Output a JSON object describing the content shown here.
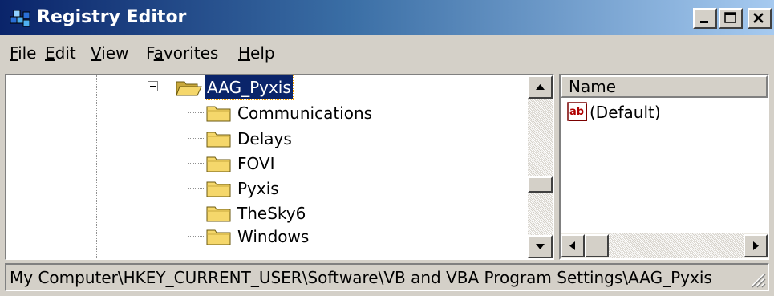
{
  "window": {
    "title": "Registry Editor",
    "controls": {
      "minimize": "_",
      "maximize": "□",
      "close": "×"
    }
  },
  "menu": {
    "file": {
      "hot": "F",
      "rest": "ile"
    },
    "edit": {
      "hot": "E",
      "rest": "dit"
    },
    "view": {
      "hot": "V",
      "rest": "iew"
    },
    "favorites": {
      "pre": "F",
      "hot": "a",
      "rest": "vorites"
    },
    "help": {
      "hot": "H",
      "rest": "elp"
    }
  },
  "tree": {
    "selected": "AAG_Pyxis",
    "children": [
      "Communications",
      "Delays",
      "FOVI",
      "Pyxis",
      "TheSky6",
      "Windows"
    ]
  },
  "list": {
    "column": "Name",
    "items": [
      {
        "icon": "string-value-icon",
        "name": "(Default)"
      }
    ]
  },
  "status": {
    "path": "My Computer\\HKEY_CURRENT_USER\\Software\\VB and VBA Program Settings\\AAG_Pyxis"
  },
  "colors": {
    "titlebar_start": "#0a246a",
    "titlebar_end": "#a6caf0",
    "selection": "#0a246a",
    "folder": "#f5d76b",
    "chrome": "#d4d0c8"
  }
}
